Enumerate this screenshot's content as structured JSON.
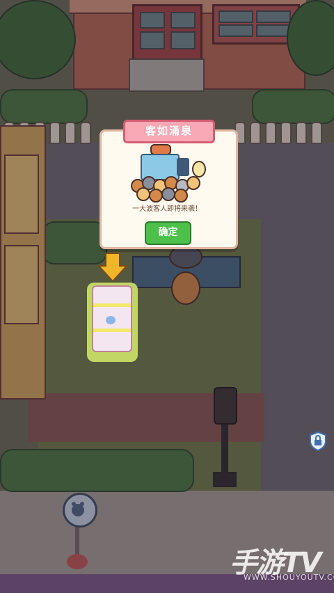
{
  "dialog": {
    "title": "客如涌泉",
    "message": "一大波客人即将来袭！",
    "confirm_label": "确定"
  },
  "watermark": {
    "brand": "手游TV",
    "url": "WWW.SHOUYOUTV.COM"
  },
  "icons": {
    "guide_arrow": "arrow-down-icon",
    "lock": "lock-icon",
    "sign": "paw-sign-icon"
  },
  "colors": {
    "dialog_tab": "#f9a8b6",
    "confirm_button": "#4cc04b",
    "highlight": "#d6ec6c"
  }
}
